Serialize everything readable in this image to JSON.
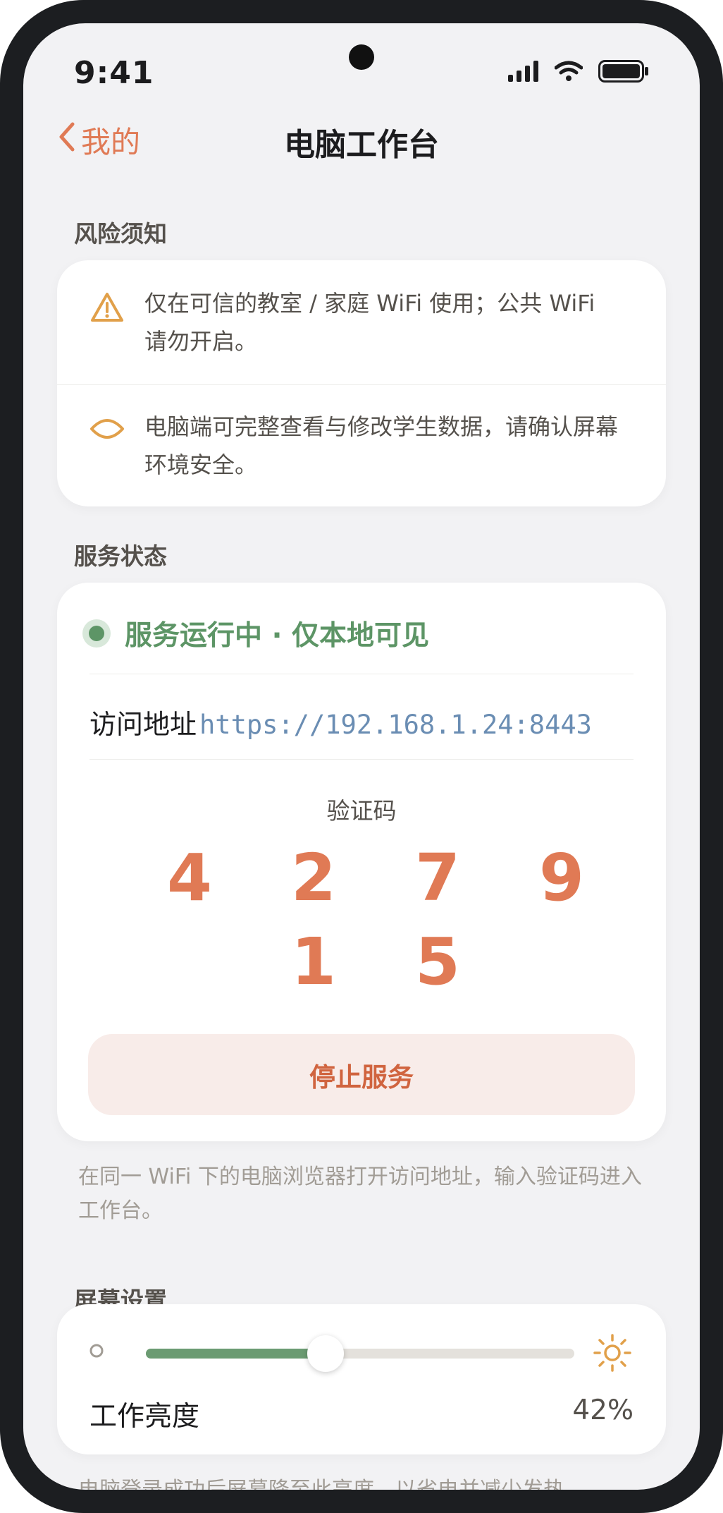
{
  "status_bar": {
    "time": "9:41"
  },
  "nav": {
    "back_label": "我的",
    "title": "电脑工作台"
  },
  "risk": {
    "section_title": "风险须知",
    "items": [
      {
        "icon": "warning-triangle-icon",
        "text": "仅在可信的教室 / 家庭 WiFi 使用；公共 WiFi 请勿开启。"
      },
      {
        "icon": "eye-icon",
        "text": "电脑端可完整查看与修改学生数据，请确认屏幕环境安全。"
      }
    ]
  },
  "service": {
    "section_title": "服务状态",
    "status_text": "服务运行中 · 仅本地可见",
    "address_label": "访问地址",
    "address_url": "https://192.168.1.24:8443",
    "code_label": "验证码",
    "code_digits": [
      "4",
      "2",
      "7",
      "9",
      "1",
      "5"
    ],
    "stop_button": "停止服务",
    "hint": "在同一 WiFi 下的电脑浏览器打开访问地址，输入验证码进入工作台。"
  },
  "screen_settings": {
    "section_title": "屏幕设置",
    "brightness_label": "工作亮度",
    "brightness_value": "42%",
    "brightness_fraction": 0.42,
    "hint": "电脑登录成功后屏幕降至此亮度，以省电并减少发热。"
  },
  "colors": {
    "accent": "#e07a55",
    "success": "#5d9566",
    "link": "#6a8db3",
    "warning": "#e1a04a"
  }
}
